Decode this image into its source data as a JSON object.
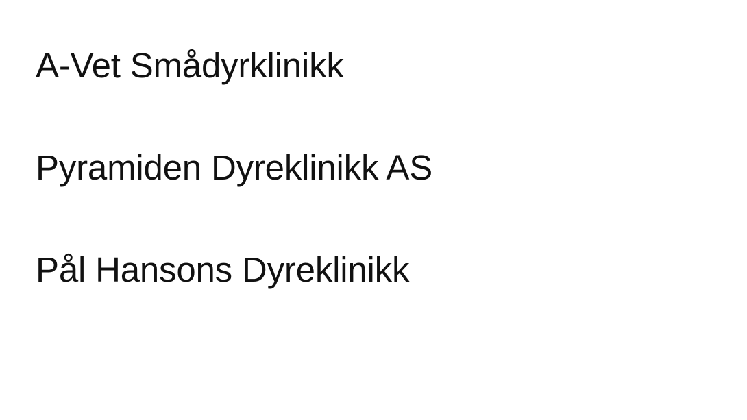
{
  "clinics": [
    {
      "name": "A-Vet Smådyrklinikk"
    },
    {
      "name": "Pyramiden Dyreklinikk AS"
    },
    {
      "name": "Pål Hansons Dyreklinikk"
    }
  ]
}
